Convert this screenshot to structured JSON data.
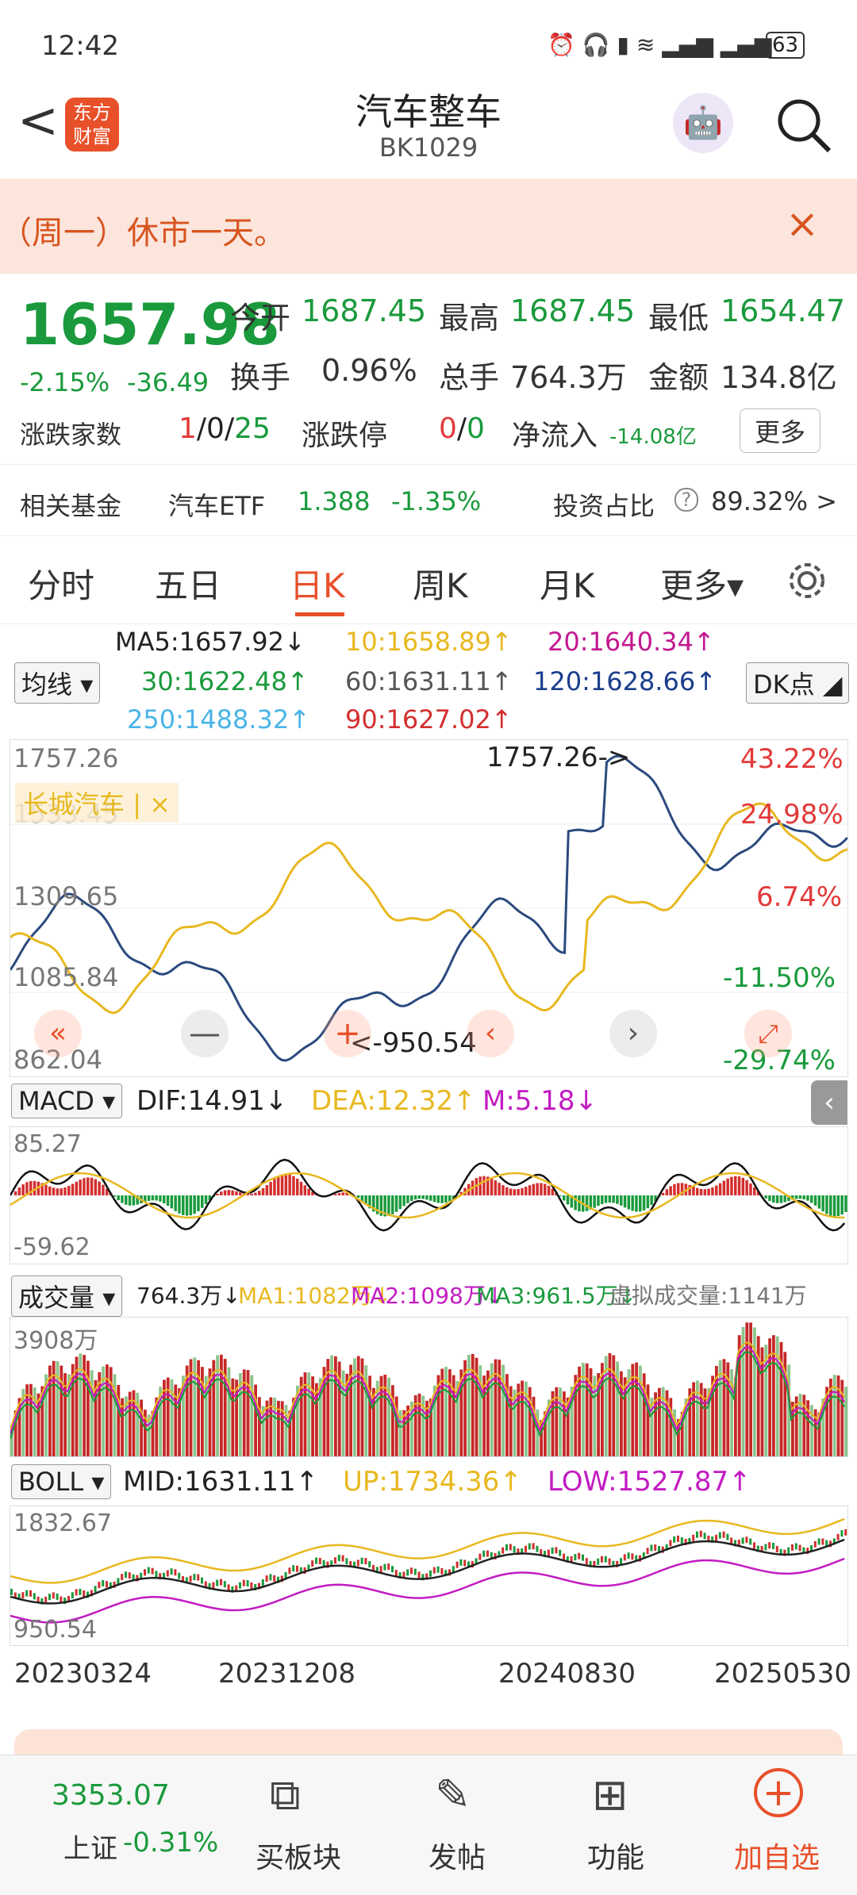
{
  "status": {
    "time": "12:42",
    "battery": "63"
  },
  "header": {
    "back_label": "<",
    "logo_text_1": "东方",
    "logo_text_2": "财富",
    "title": "汽车整车",
    "code": "BK1029"
  },
  "notice": {
    "text": "（周一）休市一天。",
    "close_label": "×"
  },
  "quote": {
    "price": "1657.98",
    "change_pct": "-2.15%",
    "change_abs": "-36.49",
    "open_label": "今开",
    "open": "1687.45",
    "high_label": "最高",
    "high": "1687.45",
    "low_label": "最低",
    "low": "1654.47",
    "turnover_label": "换手",
    "turnover": "0.96%",
    "volume_label": "总手",
    "volume": "764.3万",
    "amount_label": "金额",
    "amount": "134.8亿",
    "updown_label": "涨跌家数",
    "up": "1",
    "flat": "0",
    "down": "25",
    "limit_label": "涨跌停",
    "limit_up": "0",
    "limit_down": "0",
    "inflow_label": "净流入",
    "inflow": "-14.08亿",
    "more_label": "更多",
    "fund_label": "相关基金",
    "fund_name": "汽车ETF",
    "fund_price": "1.388",
    "fund_change": "-1.35%",
    "invest_label": "投资占比",
    "invest_value": "89.32% >"
  },
  "tabs": [
    "分时",
    "五日",
    "日K",
    "周K",
    "月K",
    "更多▾"
  ],
  "ma": {
    "select_label": "均线",
    "ma5": "MA5:1657.92↓",
    "ma10": "10:1658.89↑",
    "ma20": "20:1640.34↑",
    "ma30": "30:1622.48↑",
    "ma60": "60:1631.11↑",
    "ma120": "120:1628.66↑",
    "ma250": "250:1488.32↑",
    "ma90": "90:1627.02↑",
    "dk_label": "DK点"
  },
  "main_chart": {
    "y_labels": [
      "1757.26",
      "1533.45",
      "1309.65",
      "1085.84",
      "862.04"
    ],
    "pct_labels": [
      "43.22%",
      "24.98%",
      "6.74%",
      "-11.50%",
      "-29.74%"
    ],
    "high_marker": "1757.26->",
    "low_marker": "<-950.54",
    "overlay_label": "长城汽车",
    "colors": {
      "index": "#2b4a7e",
      "overlay": "#e8b820"
    }
  },
  "macd": {
    "select_label": "MACD",
    "dif": "DIF:14.91↓",
    "dea": "DEA:12.32↑",
    "m": "M:5.18↓",
    "y_top": "85.27",
    "y_bottom": "-59.62"
  },
  "volume": {
    "select_label": "成交量",
    "value": "764.3万↓",
    "ma1": "MA1:1082万↓",
    "ma2": "MA2:1098万↓",
    "ma3": "MA3:961.5万↓",
    "virtual": "虚拟成交量:1141万",
    "y_top": "3908万"
  },
  "boll": {
    "select_label": "BOLL",
    "mid": "MID:1631.11↑",
    "up": "UP:1734.36↑",
    "low": "LOW:1527.87↑",
    "y_top": "1832.67",
    "y_bottom": "950.54"
  },
  "dates": [
    "20230324",
    "20231208",
    "20240830",
    "20250530"
  ],
  "bottom": {
    "index_value": "3353.07",
    "index_name": "上证",
    "index_change": "-0.31%",
    "buy": "买板块",
    "post": "发帖",
    "func": "功能",
    "fav": "加自选"
  }
}
